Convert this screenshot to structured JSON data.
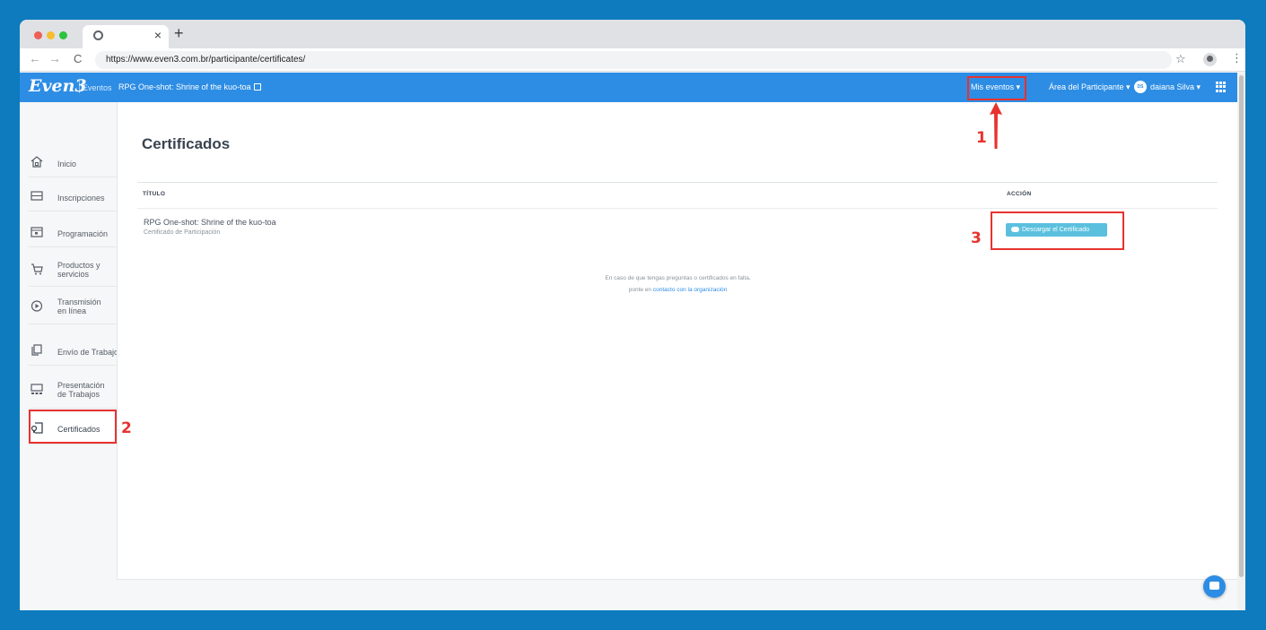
{
  "browser": {
    "url": "https://www.even3.com.br/participante/certificates/",
    "tab_close": "×",
    "new_tab": "+"
  },
  "header": {
    "logo": "Even3",
    "eventos_label": "Eventos",
    "event_name": "RPG One-shot: Shrine of the kuo-toa",
    "mis_eventos": "Mis eventos ▾",
    "area_participante": "Área del Participante ▾",
    "avatar_initials": "DS",
    "user_name": "daiana Silva ▾"
  },
  "sidebar": {
    "items": [
      {
        "label": "Inicio",
        "icon": "home-icon"
      },
      {
        "label": "Inscripciones",
        "icon": "ticket-icon"
      },
      {
        "label": "Programación",
        "icon": "calendar-icon"
      },
      {
        "label": "Productos y\nservicios",
        "icon": "cart-icon"
      },
      {
        "label": "Transmisión\nen línea",
        "icon": "play-icon"
      },
      {
        "label": "Envío de Trabajos",
        "icon": "copy-icon"
      },
      {
        "label": "Presentación\nde Trabajos",
        "icon": "presentation-icon"
      },
      {
        "label": "Certificados",
        "icon": "certificate-icon"
      }
    ]
  },
  "main": {
    "title": "Certificados",
    "table": {
      "headers": [
        "TÍTULO",
        "ACCIÓN"
      ],
      "rows": [
        {
          "title": "RPG One-shot: Shrine of the kuo-toa",
          "subtitle": "Certificado de Participación",
          "action": "Descargar el Certificado"
        }
      ]
    },
    "note_line1": "En caso de que tengas preguntas o certificados en falta,",
    "note_line2_prefix": "ponte en ",
    "note_line2_link": "contacto con la organización"
  },
  "annotations": {
    "colors": {
      "red": "#e8322f"
    },
    "labels": [
      "1",
      "2",
      "3"
    ]
  },
  "colors": {
    "header_blue": "#2d8de4",
    "background_blue": "#0d7bbd",
    "button_info": "#5bc0de"
  }
}
